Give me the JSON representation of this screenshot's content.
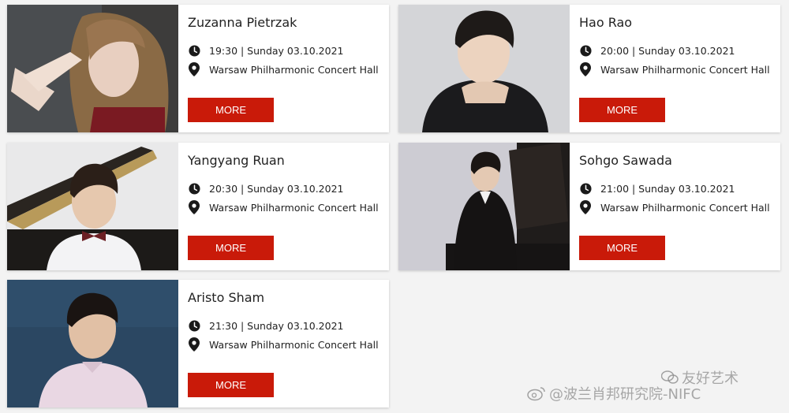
{
  "more_label": "MORE",
  "venue": "Warsaw Philharmonic Concert Hall",
  "accent_color": "#c91a09",
  "concerts": [
    {
      "name": "Zuzanna Pietrzak",
      "datetime": "19:30 | Sunday 03.10.2021",
      "photo": "performer-photo-hands-raised"
    },
    {
      "name": "Hao Rao",
      "datetime": "20:00 | Sunday 03.10.2021",
      "photo": "performer-photo-chin-on-hands"
    },
    {
      "name": "Yangyang Ruan",
      "datetime": "20:30 | Sunday 03.10.2021",
      "photo": "performer-photo-bow-tie-piano"
    },
    {
      "name": "Sohgo Sawada",
      "datetime": "21:00 | Sunday 03.10.2021",
      "photo": "performer-photo-tuxedo-piano"
    },
    {
      "name": "Aristo Sham",
      "datetime": "21:30 | Sunday 03.10.2021",
      "photo": "performer-photo-pink-shirt"
    }
  ],
  "watermark": {
    "line1": "友好艺术",
    "line2": "@波兰肖邦研究院-NIFC"
  }
}
